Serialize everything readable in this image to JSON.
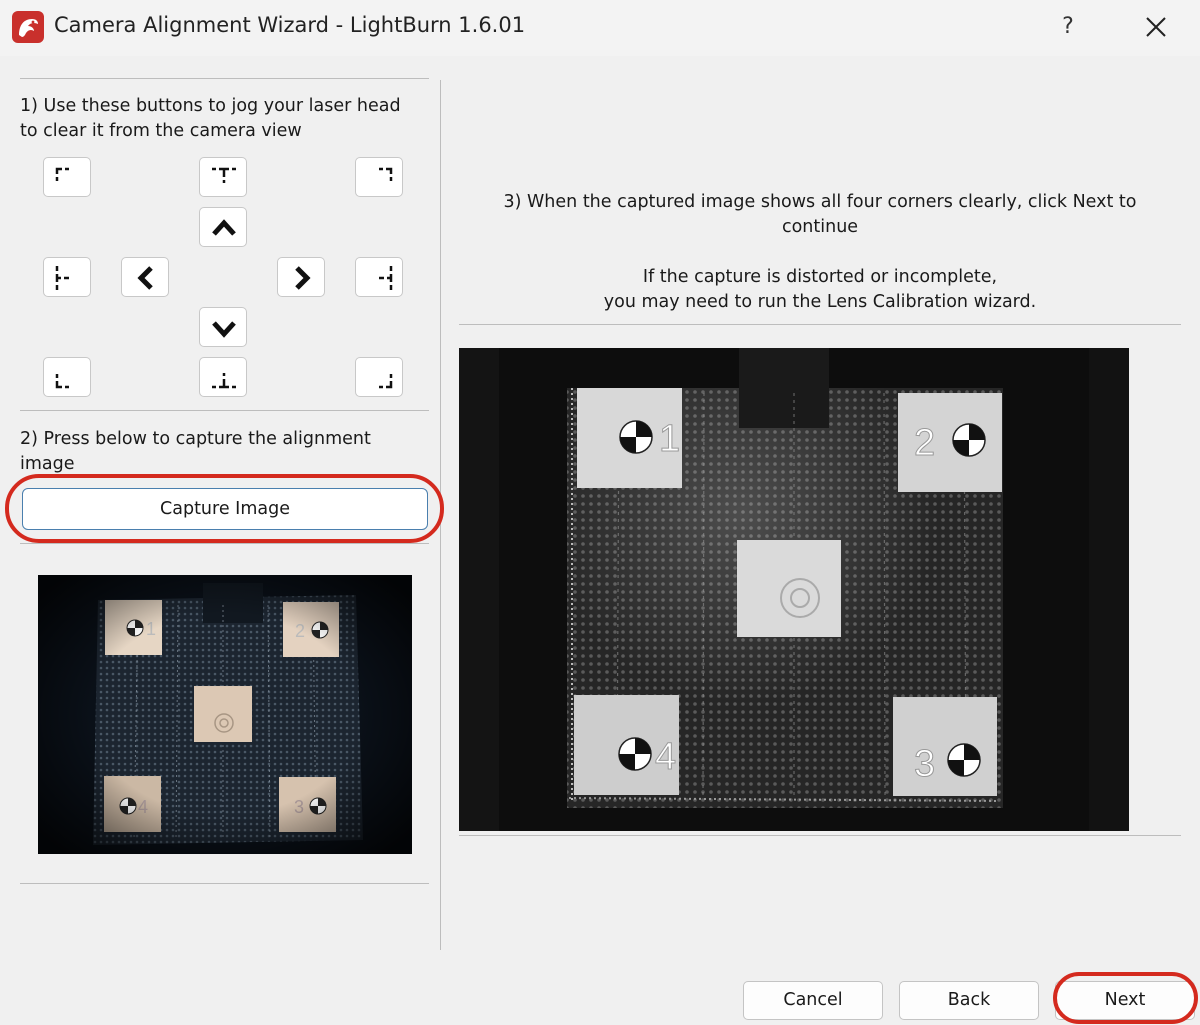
{
  "window": {
    "title": "Camera Alignment Wizard - LightBurn 1.6.01",
    "help_label": "?",
    "close_icon": "close-icon",
    "app_icon": "lightburn-dragon-icon"
  },
  "left_panel": {
    "step1_line1": "1) Use these buttons to jog your laser head",
    "step1_line2": "to clear it from the camera view",
    "jog_buttons": [
      "move-top-left-icon",
      "move-top-center-icon",
      "move-top-right-icon",
      "jog-up-icon",
      "move-middle-left-icon",
      "jog-left-icon",
      "jog-right-icon",
      "move-middle-right-icon",
      "jog-down-icon",
      "move-bottom-left-icon",
      "move-bottom-center-icon",
      "move-bottom-right-icon"
    ],
    "step2_line1": "2) Press below to capture the alignment",
    "step2_line2": "image",
    "capture_label": "Capture Image",
    "preview_markers": [
      "1",
      "2",
      "3",
      "4"
    ]
  },
  "right_panel": {
    "step3_line1": "3) When the captured image shows all four corners clearly, click Next to",
    "step3_line2": "continue",
    "note_line1": "If the capture is distorted or incomplete,",
    "note_line2": "you may need to run the Lens Calibration wizard.",
    "capture_markers": [
      "1",
      "2",
      "3",
      "4"
    ]
  },
  "footer": {
    "cancel_label": "Cancel",
    "back_label": "Back",
    "next_label": "Next"
  },
  "colors": {
    "highlight": "#d42a1e",
    "capture_border": "#4a7fae",
    "window_bg": "#f0f0f0"
  }
}
